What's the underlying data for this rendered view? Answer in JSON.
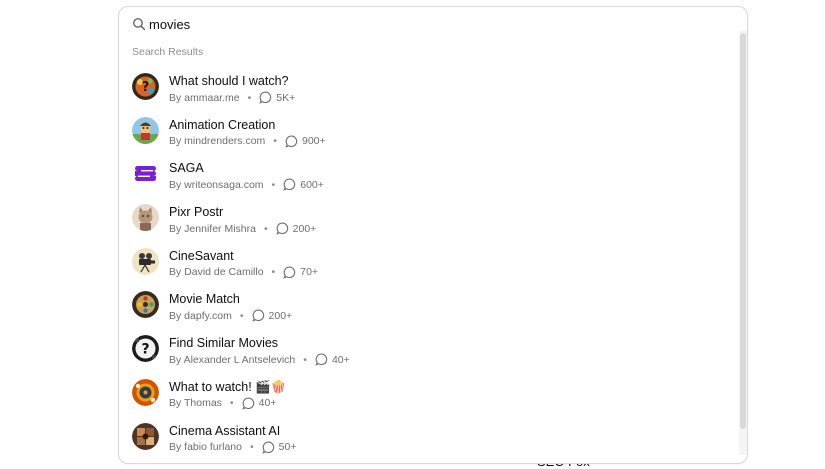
{
  "background": {
    "partial_text": "SEO Fox"
  },
  "search": {
    "value": "movies"
  },
  "section_label": "Search Results",
  "results": [
    {
      "title": "What should I watch?",
      "author": "By ammaar.me",
      "count": "5K+",
      "avatar": "question-mark-popcorn"
    },
    {
      "title": "Animation Creation",
      "author": "By mindrenders.com",
      "count": "900+",
      "avatar": "animated-character"
    },
    {
      "title": "SAGA",
      "author": "By writeonsaga.com",
      "count": "600+",
      "avatar": "saga-logo"
    },
    {
      "title": "Pixr Postr",
      "author": "By Jennifer Mishra",
      "count": "200+",
      "avatar": "cat-portrait"
    },
    {
      "title": "CineSavant",
      "author": "By David de Camillo",
      "count": "70+",
      "avatar": "film-camera"
    },
    {
      "title": "Movie Match",
      "author": "By dapfy.com",
      "count": "200+",
      "avatar": "film-reel"
    },
    {
      "title": "Find Similar Movies",
      "author": "By Alexander L Antselevich",
      "count": "40+",
      "avatar": "question-mark-film"
    },
    {
      "title": "What to watch! 🎬🍿",
      "author": "By Thomas",
      "count": "40+",
      "avatar": "popcorn-reel"
    },
    {
      "title": "Cinema Assistant AI",
      "author": "By fabio furlano",
      "count": "50+",
      "avatar": "cinema-collage"
    }
  ],
  "colors": {
    "saga_purple": "#7b1fd6",
    "muted_text": "#6e6e6e",
    "border": "#d9d9d9"
  }
}
